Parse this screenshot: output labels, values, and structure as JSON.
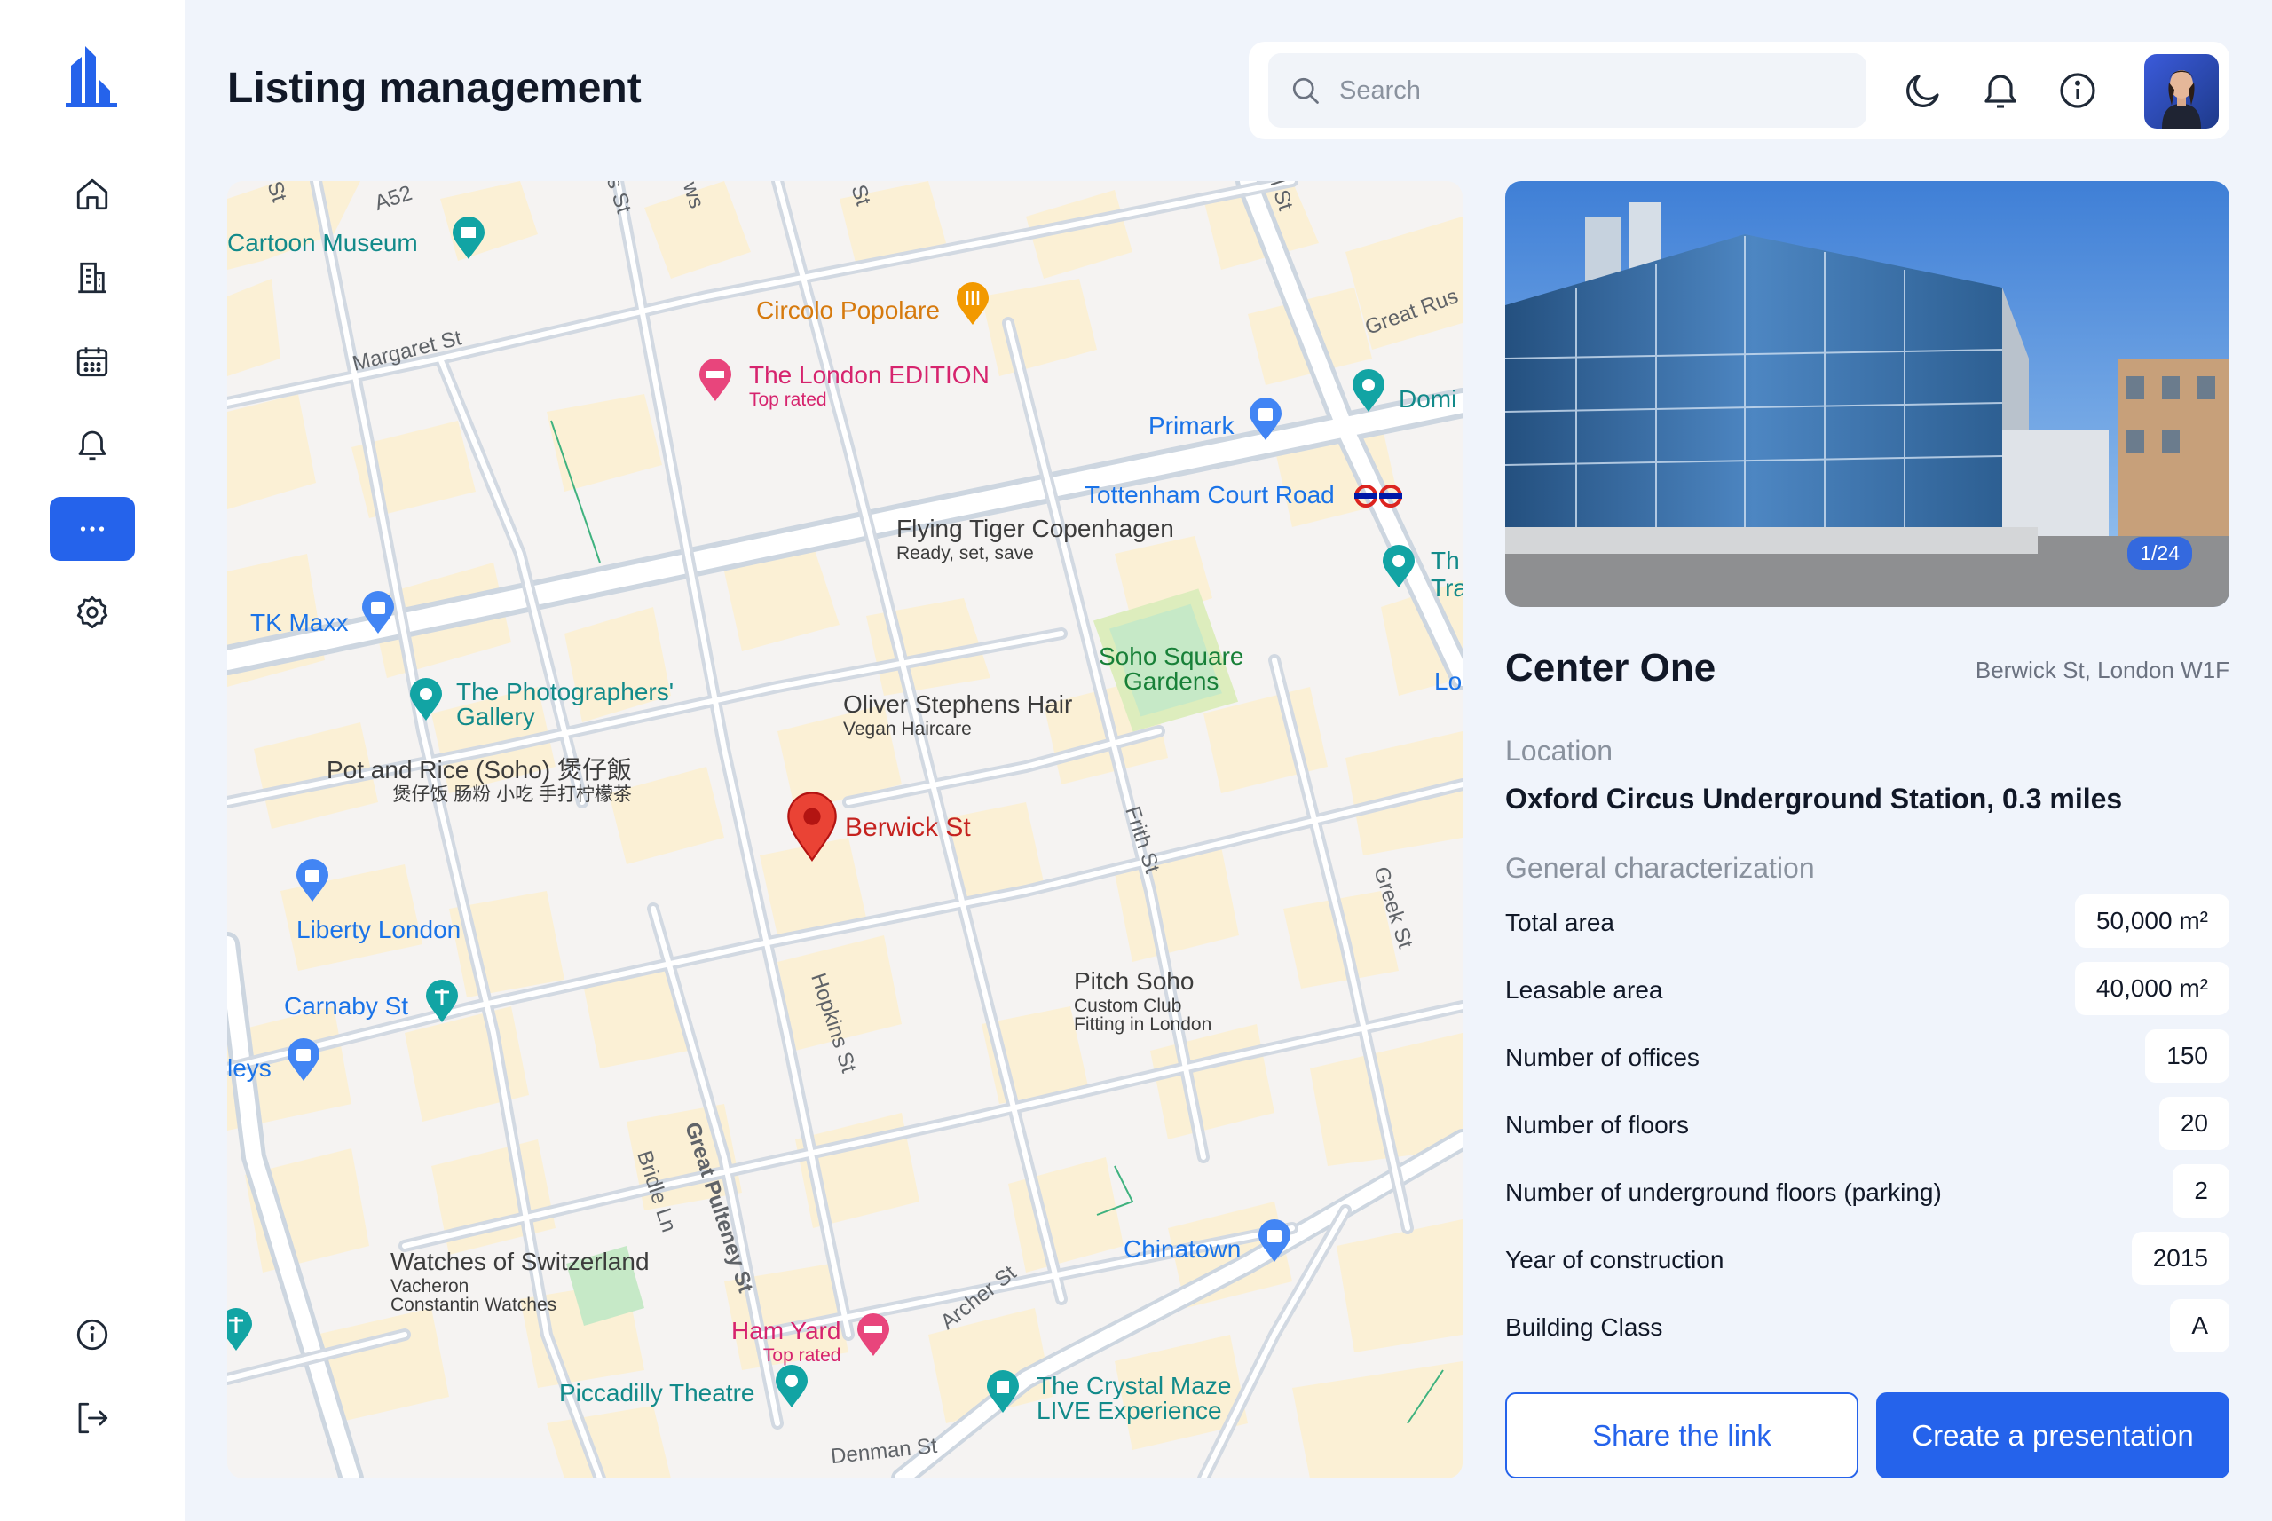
{
  "app": {
    "title": "Listing management"
  },
  "search": {
    "placeholder": "Search"
  },
  "sidebar": {
    "items": [
      {
        "icon": "home-icon"
      },
      {
        "icon": "building-icon"
      },
      {
        "icon": "calendar-icon"
      },
      {
        "icon": "bell-icon"
      },
      {
        "icon": "more-icon",
        "active": true
      },
      {
        "icon": "gear-icon"
      }
    ],
    "bottom": [
      {
        "icon": "info-icon"
      },
      {
        "icon": "logout-icon"
      }
    ]
  },
  "header": {
    "icons": [
      "moon-icon",
      "bell-icon",
      "info-icon",
      "avatar"
    ]
  },
  "map": {
    "labels": {
      "cartoon_museum": "Cartoon Museum",
      "margaret_st": "Margaret St",
      "circolo": "Circolo Popolare",
      "london_edition": "The London EDITION",
      "london_edition_sub": "Top rated",
      "primark": "Primark",
      "great_rus": "Great Rus",
      "domi": "Domi",
      "tottenham": "Tottenham Court Road",
      "flying_tiger": "Flying Tiger Copenhagen",
      "flying_tiger_sub": "Ready, set, save",
      "tk_maxx": "TK Maxx",
      "photographers": "The Photographers'",
      "photographers_2": "Gallery",
      "soho_square": "Soho Square",
      "soho_square_2": "Gardens",
      "oliver": "Oliver Stephens Hair",
      "oliver_sub": "Vegan Haircare",
      "pot_rice": "Pot and Rice (Soho) 煲仔飯",
      "pot_rice_sub": "煲仔饭 肠粉 小吃 手打柠檬茶",
      "berwick": "Berwick St",
      "frith": "Frith St",
      "greek": "Greek St",
      "liberty": "Liberty London",
      "carnaby": "Carnaby St",
      "pitch": "Pitch Soho",
      "pitch_sub1": "Custom Club",
      "pitch_sub2": "Fitting in London",
      "leys": "leys",
      "hopkins": "Hopkins St",
      "bridle": "Bridle Ln",
      "great_pulteney": "Great Pulteney St",
      "chinatown": "Chinatown",
      "watches": "Watches of Switzerland",
      "watches_sub1": "Vacheron",
      "watches_sub2": "Constantin Watches",
      "ham_yard": "Ham Yard",
      "ham_yard_sub": "Top rated",
      "archer": "Archer St",
      "piccadilly": "Piccadilly Theatre",
      "crystal": "The Crystal Maze",
      "crystal_2": "LIVE Experience",
      "denman": "Denman St",
      "a52": "A52",
      "st1": "St",
      "st2": "s St",
      "st3": "ws",
      "st4": "St",
      "st5": "l St",
      "th": "Th",
      "tra": "Tra",
      "lo": "Lo"
    }
  },
  "property": {
    "photo_counter": "1/24",
    "name": "Center One",
    "address": "Berwick St, London W1F",
    "location_label": "Location",
    "location_value": "Oxford Circus Underground Station, 0.3 miles",
    "characterization_label": "General characterization",
    "characteristics": [
      {
        "label": "Total area",
        "value": "50,000 m²"
      },
      {
        "label": "Leasable area",
        "value": "40,000 m²"
      },
      {
        "label": "Number of offices",
        "value": "150"
      },
      {
        "label": "Number of floors",
        "value": "20"
      },
      {
        "label": "Number of underground floors (parking)",
        "value": "2"
      },
      {
        "label": "Year of construction",
        "value": "2015"
      },
      {
        "label": "Building Class",
        "value": "A"
      }
    ]
  },
  "actions": {
    "share": "Share the link",
    "create": "Create a presentation"
  }
}
